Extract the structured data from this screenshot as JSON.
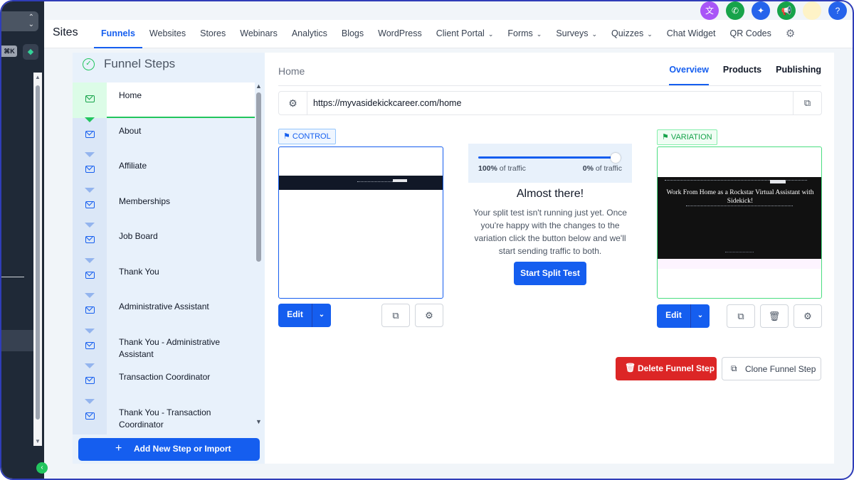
{
  "header": {
    "brand": "Sites",
    "nav": [
      {
        "label": "Funnels",
        "active": true
      },
      {
        "label": "Websites"
      },
      {
        "label": "Stores"
      },
      {
        "label": "Webinars"
      },
      {
        "label": "Analytics"
      },
      {
        "label": "Blogs"
      },
      {
        "label": "WordPress"
      },
      {
        "label": "Client Portal",
        "dropdown": true
      },
      {
        "label": "Forms",
        "dropdown": true
      },
      {
        "label": "Surveys",
        "dropdown": true
      },
      {
        "label": "Quizzes",
        "dropdown": true
      },
      {
        "label": "Chat Widget"
      },
      {
        "label": "QR Codes"
      }
    ],
    "icons": [
      {
        "name": "translate-icon",
        "color": "#a855f7",
        "glyph": "文"
      },
      {
        "name": "phone-icon",
        "color": "#16a34a",
        "glyph": "✆"
      },
      {
        "name": "sparkle-icon",
        "color": "#2563eb",
        "glyph": "✦"
      },
      {
        "name": "megaphone-icon",
        "color": "#16a34a",
        "glyph": "📢"
      },
      {
        "name": "notification-icon",
        "color": "#fef3c7",
        "glyph": ""
      },
      {
        "name": "help-icon",
        "color": "#2563eb",
        "glyph": "?"
      }
    ]
  },
  "left_nav": {
    "kbd": "⌘K",
    "spark_icon": "sparkle-icon"
  },
  "steps_panel": {
    "title": "Funnel Steps",
    "steps": [
      {
        "label": "Home",
        "active": true
      },
      {
        "label": "About"
      },
      {
        "label": "Affiliate"
      },
      {
        "label": "Memberships"
      },
      {
        "label": "Job Board"
      },
      {
        "label": "Thank You"
      },
      {
        "label": "Administrative Assistant"
      },
      {
        "label": "Thank You - Administrative Assistant"
      },
      {
        "label": "Transaction Coordinator"
      },
      {
        "label": "Thank You - Transaction Coordinator"
      }
    ],
    "add_button": "Add New Step or Import"
  },
  "main": {
    "breadcrumb": "Home",
    "tabs": [
      {
        "label": "Overview",
        "active": true
      },
      {
        "label": "Products"
      },
      {
        "label": "Publishing"
      }
    ],
    "url": "https://myvasidekickcareer.com/home",
    "control": {
      "badge": "CONTROL",
      "edit": "Edit"
    },
    "variation": {
      "badge": "VARIATION",
      "edit": "Edit",
      "preview_heading": "Work From Home as a Rockstar Virtual Assistant with Sidekick!"
    },
    "split_test": {
      "control_traffic_pct": 100,
      "left_label": "100%",
      "left_suffix": " of traffic",
      "right_label": "0%",
      "right_suffix": " of traffic",
      "title": "Almost there!",
      "description": "Your split test isn't running just yet. Once you're happy with the changes to the variation click the button below and we'll start sending traffic to both.",
      "start_button": "Start Split Test"
    },
    "delete_button": "Delete Funnel Step",
    "clone_button": "Clone Funnel Step"
  },
  "colors": {
    "primary": "#155eef",
    "success": "#22c55e",
    "danger": "#dc2626",
    "sidebar": "#1f2937"
  }
}
